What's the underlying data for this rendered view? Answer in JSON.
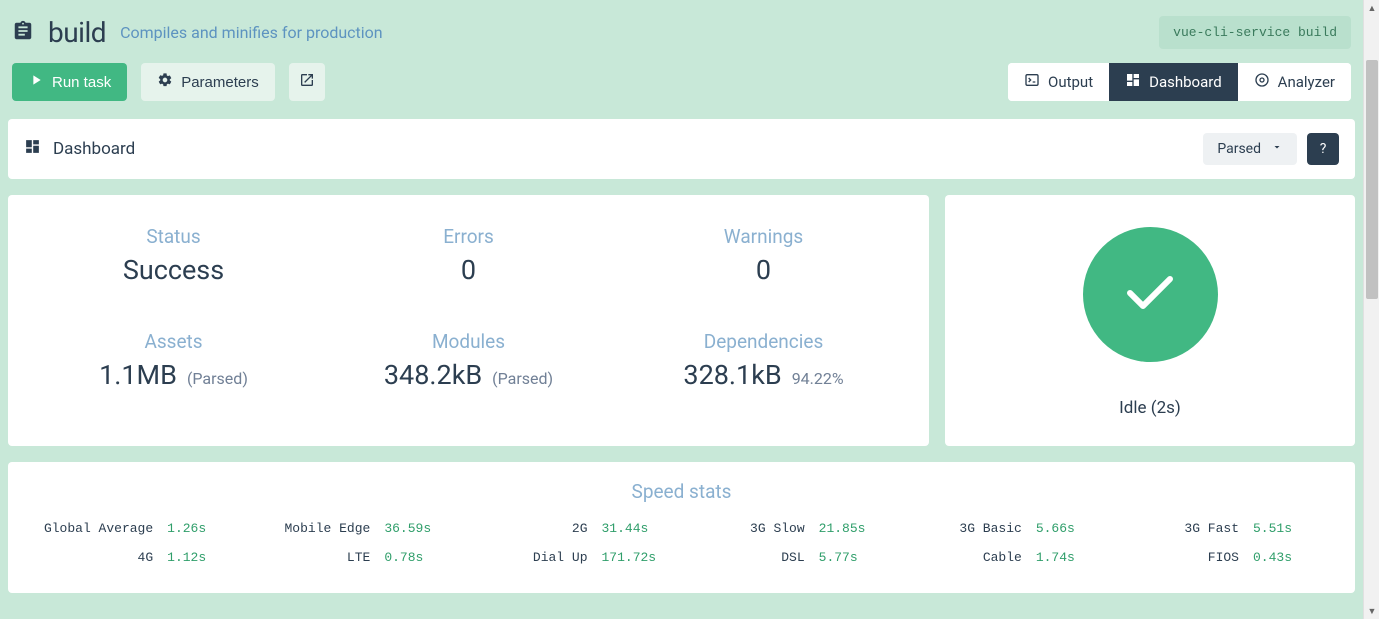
{
  "header": {
    "title": "build",
    "subtitle": "Compiles and minifies for production",
    "command": "vue-cli-service build"
  },
  "toolbar": {
    "run_label": "Run task",
    "params_label": "Parameters"
  },
  "tabs": {
    "output": "Output",
    "dashboard": "Dashboard",
    "analyzer": "Analyzer"
  },
  "dash_header": {
    "title": "Dashboard",
    "mode_selected": "Parsed"
  },
  "stats": {
    "status": {
      "label": "Status",
      "value": "Success"
    },
    "errors": {
      "label": "Errors",
      "value": "0"
    },
    "warnings": {
      "label": "Warnings",
      "value": "0"
    },
    "assets": {
      "label": "Assets",
      "value": "1.1MB",
      "sub": "(Parsed)"
    },
    "modules": {
      "label": "Modules",
      "value": "348.2kB",
      "sub": "(Parsed)"
    },
    "deps": {
      "label": "Dependencies",
      "value": "328.1kB",
      "sub": "94.22%"
    }
  },
  "run_status": {
    "text": "Idle (2s)"
  },
  "speed": {
    "title": "Speed stats",
    "rows": [
      [
        {
          "name": "Global Average",
          "value": "1.26s"
        },
        {
          "name": "Mobile Edge",
          "value": "36.59s"
        },
        {
          "name": "2G",
          "value": "31.44s"
        },
        {
          "name": "3G Slow",
          "value": "21.85s"
        },
        {
          "name": "3G Basic",
          "value": "5.66s"
        },
        {
          "name": "3G Fast",
          "value": "5.51s"
        }
      ],
      [
        {
          "name": "4G",
          "value": "1.12s"
        },
        {
          "name": "LTE",
          "value": "0.78s"
        },
        {
          "name": "Dial Up",
          "value": "171.72s"
        },
        {
          "name": "DSL",
          "value": "5.77s"
        },
        {
          "name": "Cable",
          "value": "1.74s"
        },
        {
          "name": "FIOS",
          "value": "0.43s"
        }
      ]
    ]
  }
}
